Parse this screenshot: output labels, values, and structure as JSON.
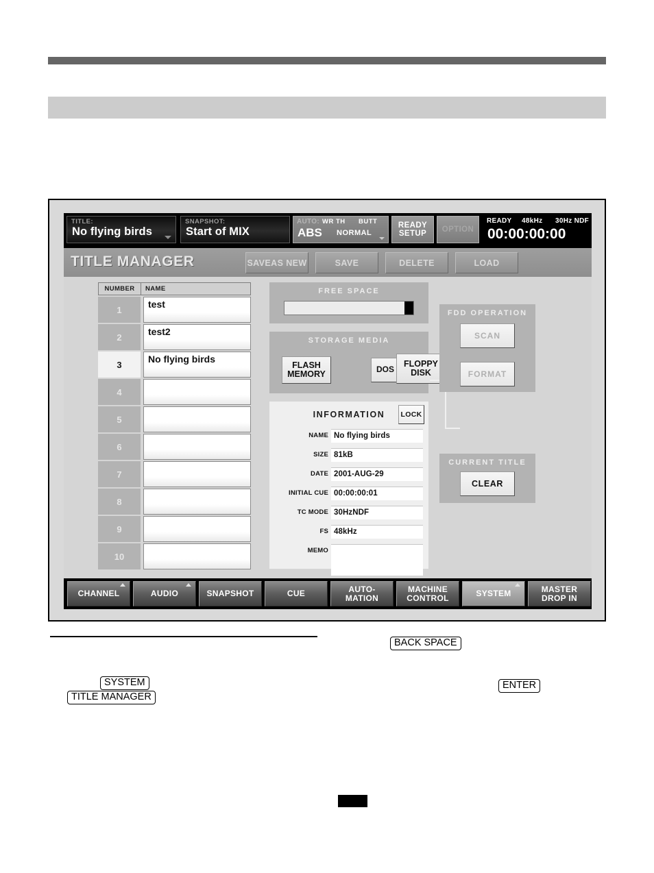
{
  "document": {
    "keycaps": [
      {
        "id": "kc-backspace",
        "label": "BACK SPACE"
      },
      {
        "id": "kc-enter",
        "label": "ENTER"
      },
      {
        "id": "kc-system",
        "label": "SYSTEM"
      },
      {
        "id": "kc-titlemgr",
        "label": "TITLE MANAGER"
      }
    ]
  },
  "status_bar": {
    "title_field": {
      "label": "TITLE:",
      "value": "No flying birds"
    },
    "snapshot_field": {
      "label": "SNAPSHOT:",
      "value": "Start of MIX"
    },
    "auto_field": {
      "label": "AUTO:",
      "wr_th": "WR TH",
      "butt": "BUTT",
      "mode": "ABS",
      "sub_mode": "NORMAL"
    },
    "ready_setup_button": "READY\nSETUP",
    "ready_setup_line1": "READY",
    "ready_setup_line2": "SETUP",
    "option_button": "OPTION",
    "timecode": {
      "status": "READY",
      "sample_rate": "48kHz",
      "tc_mode": "30Hz NDF",
      "value": "00:00:00:00"
    }
  },
  "header": {
    "screen_title": "TITLE MANAGER",
    "buttons": [
      {
        "line1": "SAVE",
        "line2": "AS NEW"
      },
      {
        "line1": "SAVE",
        "line2": ""
      },
      {
        "line1": "DELETE",
        "line2": ""
      },
      {
        "line1": "LOAD",
        "line2": ""
      }
    ]
  },
  "title_list": {
    "columns": {
      "number": "NUMBER",
      "name": "NAME"
    },
    "rows": [
      {
        "number": "1",
        "name": "test",
        "selected": false
      },
      {
        "number": "2",
        "name": "test2",
        "selected": false
      },
      {
        "number": "3",
        "name": "No flying birds",
        "selected": true
      },
      {
        "number": "4",
        "name": "",
        "selected": false
      },
      {
        "number": "5",
        "name": "",
        "selected": false
      },
      {
        "number": "6",
        "name": "",
        "selected": false
      },
      {
        "number": "7",
        "name": "",
        "selected": false
      },
      {
        "number": "8",
        "name": "",
        "selected": false
      },
      {
        "number": "9",
        "name": "",
        "selected": false
      },
      {
        "number": "10",
        "name": "",
        "selected": false
      }
    ]
  },
  "free_space": {
    "title": "FREE SPACE",
    "free_percent": 93,
    "used_percent": 7
  },
  "storage_media": {
    "title": "STORAGE MEDIA",
    "flash_memory_line1": "FLASH",
    "flash_memory_line2": "MEMORY",
    "dos_button": "DOS",
    "floppy_line1": "FLOPPY",
    "floppy_line2": "DISK"
  },
  "information": {
    "title": "INFORMATION",
    "lock_button": "LOCK",
    "fields": [
      {
        "label": "NAME",
        "value": "No flying birds"
      },
      {
        "label": "SIZE",
        "value": "81kB"
      },
      {
        "label": "DATE",
        "value": "2001-AUG-29"
      },
      {
        "label": "INITIAL CUE",
        "value": "00:00:00:01"
      },
      {
        "label": "TC MODE",
        "value": "30HzNDF"
      },
      {
        "label": "FS",
        "value": "48kHz"
      },
      {
        "label": "MEMO",
        "value": ""
      }
    ]
  },
  "fdd_operation": {
    "title": "FDD OPERATION",
    "scan_button": "SCAN",
    "format_button": "FORMAT"
  },
  "current_title": {
    "title": "CURRENT TITLE",
    "clear_button": "CLEAR"
  },
  "tabs": [
    {
      "line1": "CHANNEL",
      "line2": "",
      "arrow": true,
      "active": false
    },
    {
      "line1": "AUDIO",
      "line2": "",
      "arrow": true,
      "active": false
    },
    {
      "line1": "SNAPSHOT",
      "line2": "",
      "arrow": false,
      "active": false
    },
    {
      "line1": "CUE",
      "line2": "",
      "arrow": false,
      "active": false
    },
    {
      "line1": "AUTO-",
      "line2": "MATION",
      "arrow": false,
      "active": false
    },
    {
      "line1": "MACHINE",
      "line2": "CONTROL",
      "arrow": false,
      "active": false
    },
    {
      "line1": "SYSTEM",
      "line2": "",
      "arrow": true,
      "active": true
    },
    {
      "line1": "MASTER",
      "line2": "DROP IN",
      "arrow": false,
      "active": false
    }
  ],
  "colors": {
    "screen_bg": "#d5d5d5",
    "panel_bg": "#b3b3b3",
    "statusbar_bg": "#000000",
    "header_bg": "#9e9e9e",
    "selected_row": "#f2f2f2"
  }
}
